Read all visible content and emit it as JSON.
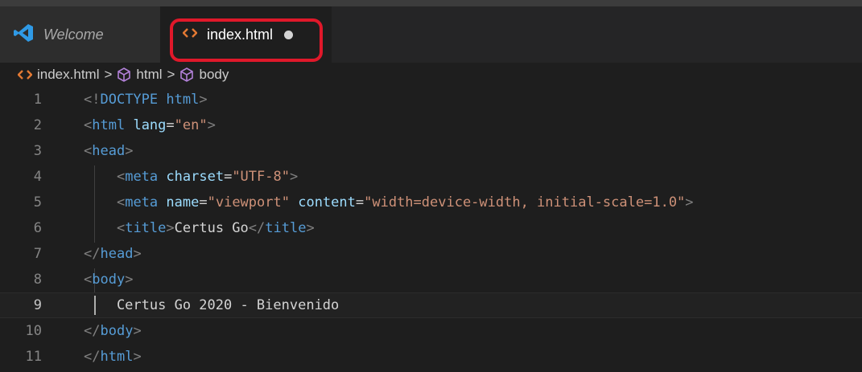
{
  "tabs": {
    "welcome_label": "Welcome",
    "index_label": "index.html"
  },
  "breadcrumb": {
    "file": "index.html",
    "node1": "html",
    "node2": "body",
    "sep": ">"
  },
  "editor": {
    "lines": [
      {
        "no": "1",
        "parts": [
          [
            "punc",
            "<!"
          ],
          [
            "tag",
            "DOCTYPE"
          ],
          [
            "text",
            " "
          ],
          [
            "tag",
            "html"
          ],
          [
            "punc",
            ">"
          ]
        ]
      },
      {
        "no": "2",
        "parts": [
          [
            "punc",
            "<"
          ],
          [
            "tag",
            "html"
          ],
          [
            "text",
            " "
          ],
          [
            "attr",
            "lang"
          ],
          [
            "text",
            "="
          ],
          [
            "str",
            "\"en\""
          ],
          [
            "punc",
            ">"
          ]
        ]
      },
      {
        "no": "3",
        "parts": [
          [
            "punc",
            "<"
          ],
          [
            "tag",
            "head"
          ],
          [
            "punc",
            ">"
          ]
        ]
      },
      {
        "no": "4",
        "parts": [
          [
            "text",
            "    "
          ],
          [
            "punc",
            "<"
          ],
          [
            "tag",
            "meta"
          ],
          [
            "text",
            " "
          ],
          [
            "attr",
            "charset"
          ],
          [
            "text",
            "="
          ],
          [
            "str",
            "\"UTF-8\""
          ],
          [
            "punc",
            ">"
          ]
        ]
      },
      {
        "no": "5",
        "parts": [
          [
            "text",
            "    "
          ],
          [
            "punc",
            "<"
          ],
          [
            "tag",
            "meta"
          ],
          [
            "text",
            " "
          ],
          [
            "attr",
            "name"
          ],
          [
            "text",
            "="
          ],
          [
            "str",
            "\"viewport\""
          ],
          [
            "text",
            " "
          ],
          [
            "attr",
            "content"
          ],
          [
            "text",
            "="
          ],
          [
            "str",
            "\"width=device-width, initial-scale=1.0\""
          ],
          [
            "punc",
            ">"
          ]
        ]
      },
      {
        "no": "6",
        "parts": [
          [
            "text",
            "    "
          ],
          [
            "punc",
            "<"
          ],
          [
            "tag",
            "title"
          ],
          [
            "punc",
            ">"
          ],
          [
            "text",
            "Certus Go"
          ],
          [
            "punc",
            "</"
          ],
          [
            "tag",
            "title"
          ],
          [
            "punc",
            ">"
          ]
        ]
      },
      {
        "no": "7",
        "parts": [
          [
            "punc",
            "</"
          ],
          [
            "tag",
            "head"
          ],
          [
            "punc",
            ">"
          ]
        ]
      },
      {
        "no": "8",
        "parts": [
          [
            "punc",
            "<"
          ],
          [
            "tag",
            "body"
          ],
          [
            "punc",
            ">"
          ]
        ]
      },
      {
        "no": "9",
        "parts": [
          [
            "text",
            "    Certus Go 2020 - Bienvenido"
          ]
        ]
      },
      {
        "no": "10",
        "parts": [
          [
            "punc",
            "</"
          ],
          [
            "tag",
            "body"
          ],
          [
            "punc",
            ">"
          ]
        ]
      },
      {
        "no": "11",
        "parts": [
          [
            "punc",
            "</"
          ],
          [
            "tag",
            "html"
          ],
          [
            "punc",
            ">"
          ]
        ]
      }
    ]
  }
}
